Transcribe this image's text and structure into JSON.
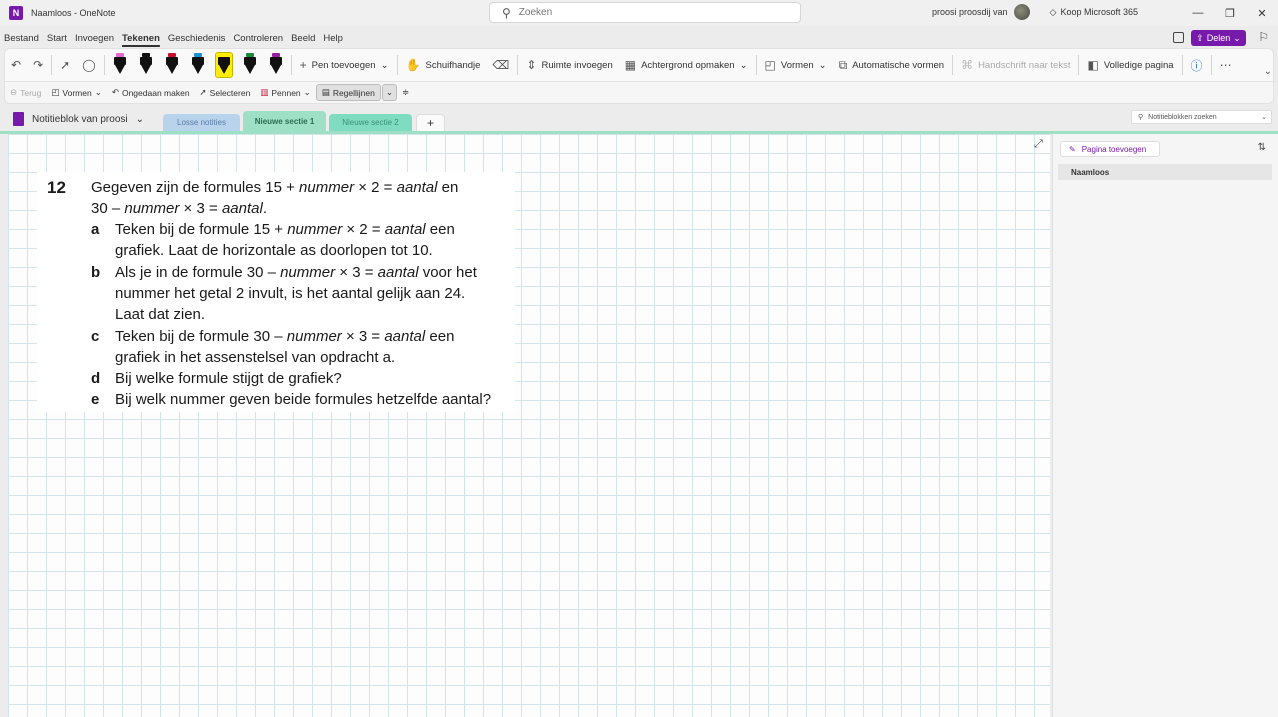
{
  "window": {
    "app_title": "Naamloos - OneNote",
    "search_placeholder": "Zoeken",
    "user_name": "proosi proosdij van",
    "upgrade_label": "Koop Microsoft 365",
    "controls": [
      "—",
      "❐",
      "✕"
    ]
  },
  "menu": {
    "items": [
      "Bestand",
      "Start",
      "Invoegen",
      "Tekenen",
      "Geschiedenis",
      "Controleren",
      "Beeld",
      "Help"
    ],
    "active": "Tekenen",
    "share_label": "Delen"
  },
  "ribbon": {
    "add_pen": "Pen toevoegen",
    "hand": "Schuifhandje",
    "insert_space": "Ruimte invoegen",
    "background": "Achtergrond opmaken",
    "shapes": "Vormen",
    "auto_shapes": "Automatische vormen",
    "ink_to_text": "Handschrift naar tekst",
    "full_page": "Volledige pagina",
    "pens": [
      {
        "cap": "#e06ad0",
        "selected": false
      },
      {
        "cap": "#111111",
        "selected": false
      },
      {
        "cap": "#c8102e",
        "selected": false
      },
      {
        "cap": "#1f8fd6",
        "selected": false
      },
      {
        "cap": "#ffee00",
        "selected": true
      },
      {
        "cap": "#1b8a3c",
        "selected": false
      },
      {
        "cap": "#9a1fa5",
        "selected": false
      }
    ]
  },
  "subribbon": {
    "back": "Terug",
    "shapes": "Vormen",
    "undo": "Ongedaan maken",
    "select": "Selecteren",
    "pens": "Pennen",
    "rule_lines": "Regellijnen"
  },
  "notebook": {
    "name": "Notitieblok van proosi",
    "search_placeholder": "Notitieblokken zoeken",
    "sections": [
      "Losse notities",
      "Nieuwe sectie 1",
      "Nieuwe sectie 2"
    ],
    "add_tab": "+"
  },
  "pages_pane": {
    "add_page": "Pagina toevoegen",
    "pages": [
      "Naamloos"
    ]
  },
  "exercise": {
    "number": "12",
    "intro_1a": "Gegeven zijn de formules 15 + ",
    "intro_1b": "nummer",
    "intro_1c": " × 2 = ",
    "intro_1d": "aantal",
    "intro_1e": " en",
    "intro_2a": "30 – ",
    "intro_2b": "nummer",
    "intro_2c": " × 3 = ",
    "intro_2d": "aantal",
    "intro_2e": ".",
    "a_letter": "a",
    "a1a": "Teken bij de formule 15 + ",
    "a1b": "nummer",
    "a1c": " × 2 = ",
    "a1d": "aantal",
    "a1e": " een",
    "a2": "grafiek. Laat de horizontale as doorlopen tot 10.",
    "b_letter": "b",
    "b1a": "Als je in de formule 30 – ",
    "b1b": "nummer",
    "b1c": " × 3 = ",
    "b1d": "aantal",
    "b1e": " voor het",
    "b2": "nummer het getal 2 invult, is het aantal gelijk aan 24.",
    "b3": "Laat dat zien.",
    "c_letter": "c",
    "c1a": "Teken bij de formule 30 – ",
    "c1b": "nummer",
    "c1c": " × 3 = ",
    "c1d": "aantal",
    "c1e": " een",
    "c2": "grafiek in het assenstelsel van opdracht a.",
    "d_letter": "d",
    "d1": "Bij welke formule stijgt de grafiek?",
    "e_letter": "e",
    "e1": "Bij welk nummer geven beide formules hetzelfde aantal?"
  }
}
